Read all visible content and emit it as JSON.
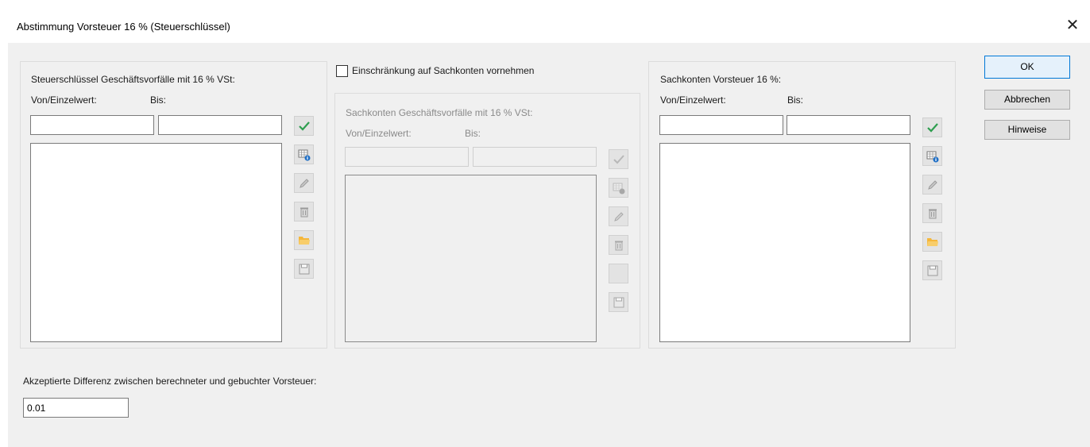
{
  "dialog": {
    "title": "Abstimmung Vorsteuer 16 % (Steuerschlüssel)",
    "close_glyph": "✕"
  },
  "left_group": {
    "title": "Steuerschlüssel Geschäftsvorfälle mit 16 % VSt:",
    "from_label": "Von/Einzelwert:",
    "to_label": "Bis:",
    "from_value": "",
    "to_value": ""
  },
  "restriction": {
    "checkbox_label": "Einschränkung auf Sachkonten vornehmen",
    "checked": false
  },
  "middle_group": {
    "title": "Sachkonten Geschäftsvorfälle mit 16 % VSt:",
    "from_label": "Von/Einzelwert:",
    "to_label": "Bis:",
    "from_value": "",
    "to_value": ""
  },
  "right_group": {
    "title": "Sachkonten Vorsteuer 16 %:",
    "from_label": "Von/Einzelwert:",
    "to_label": "Bis:",
    "from_value": "",
    "to_value": ""
  },
  "buttons": {
    "ok": "OK",
    "cancel": "Abbrechen",
    "hints": "Hinweise"
  },
  "difference": {
    "label": "Akzeptierte Differenz zwischen berechneter und gebuchter Vorsteuer:",
    "value": "0.01"
  },
  "icons": {
    "apply": "check-icon",
    "grid_info": "grid-info-icon",
    "edit": "pencil-icon",
    "delete": "trash-icon",
    "open": "folder-icon",
    "save": "floppy-icon"
  },
  "colors": {
    "check_enabled": "#2e9e4f",
    "folder": "#f5b73b",
    "info_blue": "#1f6fc5",
    "default_button_border": "#0078d7"
  }
}
